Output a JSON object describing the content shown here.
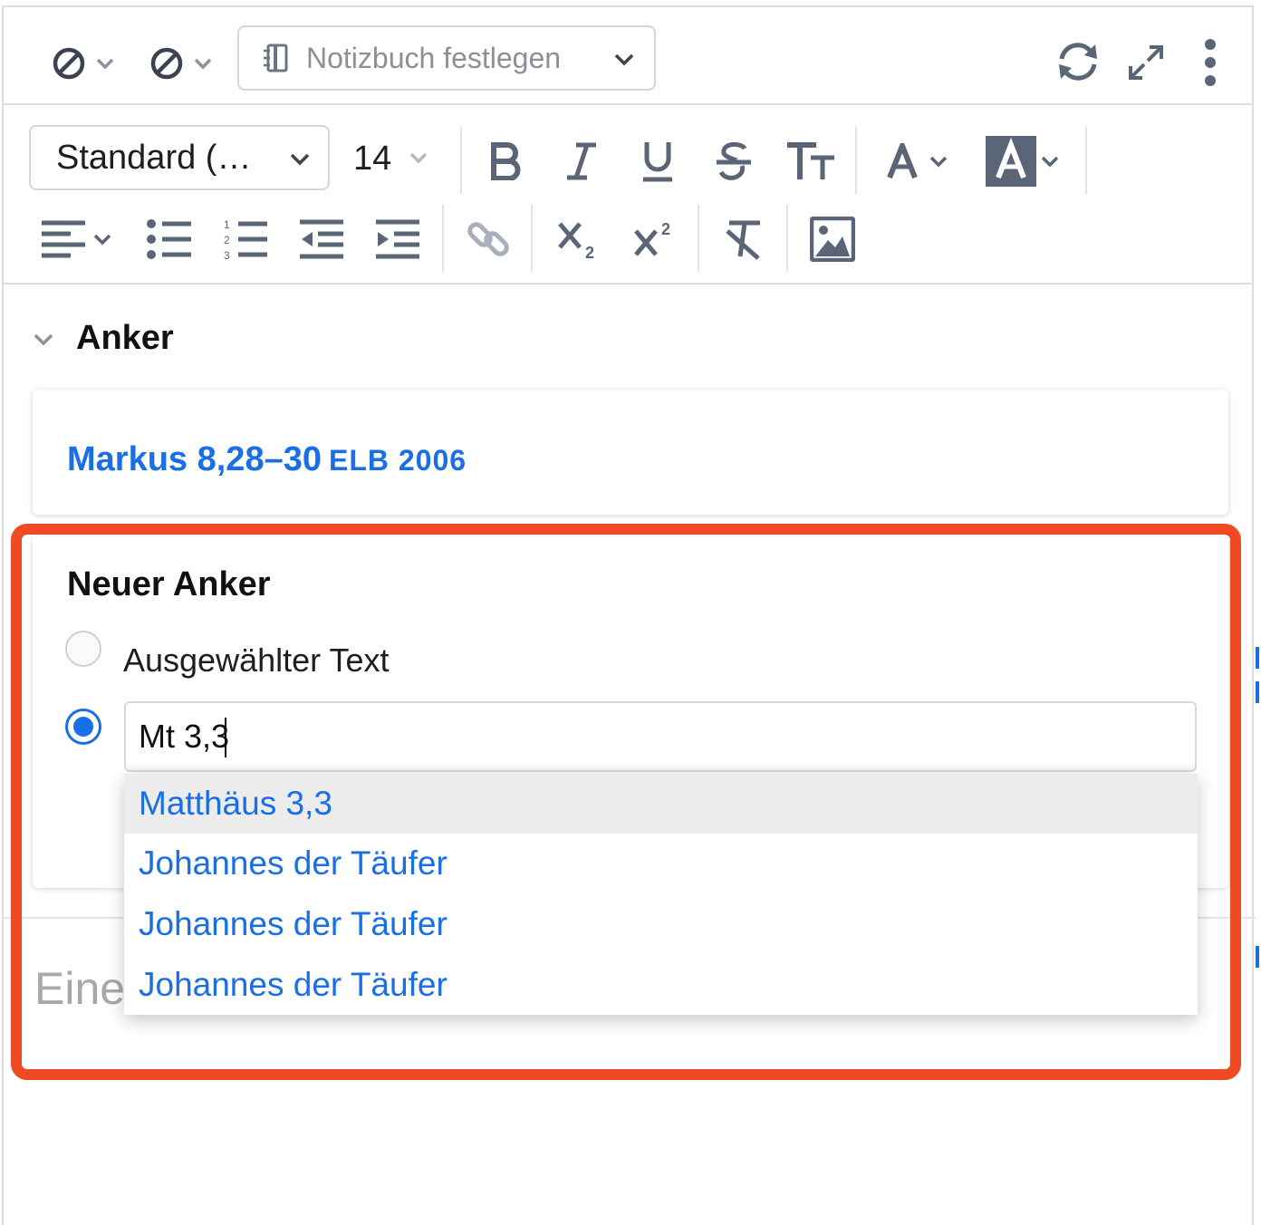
{
  "header": {
    "notebook_label": "Notizbuch festlegen",
    "icons": [
      "block-icon",
      "block-icon",
      "notebook-icon",
      "chevron-down-icon",
      "sync-icon",
      "expand-icon",
      "more-vertical-icon"
    ]
  },
  "format_toolbar": {
    "style_label": "Standard (…",
    "size_label": "14",
    "icons": [
      "bold-icon",
      "italic-icon",
      "underline-icon",
      "strikethrough-icon",
      "text-size-icon",
      "font-color-icon",
      "highlight-color-icon",
      "align-icon",
      "bullet-list-icon",
      "numbered-list-icon",
      "outdent-icon",
      "indent-icon",
      "link-icon",
      "subscript-icon",
      "superscript-icon",
      "clear-format-icon",
      "image-icon"
    ]
  },
  "anchors": {
    "section_title": "Anker",
    "existing_reference": "Markus 8,28–30",
    "existing_version": "ELB 2006"
  },
  "new_anchor": {
    "title": "Neuer Anker",
    "option_selected_text": "Ausgewählter Text",
    "reference_input_value": "Mt 3,3",
    "suggestions": [
      "Matthäus 3,3",
      "Johannes der Täufer",
      "Johannes der Täufer",
      "Johannes der Täufer"
    ]
  },
  "editor": {
    "placeholder_visible": "Eine"
  },
  "colors": {
    "accent": "#1a6ee6",
    "highlight_border": "#f04a25",
    "icon": "#5a6578"
  }
}
